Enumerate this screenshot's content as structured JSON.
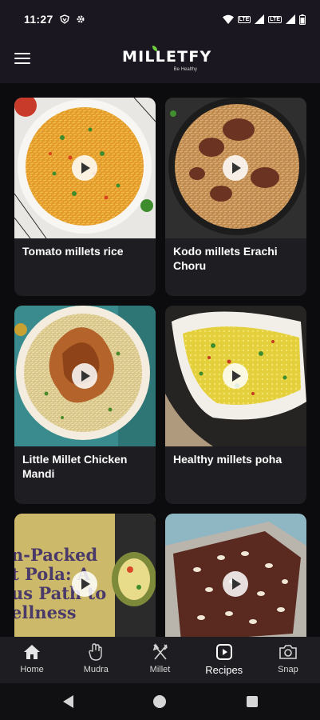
{
  "status_bar": {
    "time": "11:27"
  },
  "app_bar": {
    "logo_text": "MILLETFY",
    "logo_tagline": "Be Healthy"
  },
  "recipes": [
    {
      "title": "Tomato millets rice"
    },
    {
      "title": "Kodo millets Erachi Choru"
    },
    {
      "title": "Little Millet Chicken Mandi"
    },
    {
      "title": "Healthy millets poha"
    },
    {
      "title": "",
      "thumbnail_text": "n-Packed\nt Pola: A\nus Path to\nellness"
    },
    {
      "title": ""
    }
  ],
  "bottom_nav": {
    "active": "Recipes",
    "items": [
      {
        "label": "Home",
        "icon": "home-icon"
      },
      {
        "label": "Mudra",
        "icon": "hand-icon"
      },
      {
        "label": "Millet",
        "icon": "fork-knife-icon"
      },
      {
        "label": "Recipes",
        "icon": "play-square-icon"
      },
      {
        "label": "Snap",
        "icon": "camera-icon"
      }
    ]
  },
  "colors": {
    "background": "#0c0c0e",
    "bar": "#1b1720",
    "card": "#1e1e22",
    "nav": "#1d1d22"
  }
}
